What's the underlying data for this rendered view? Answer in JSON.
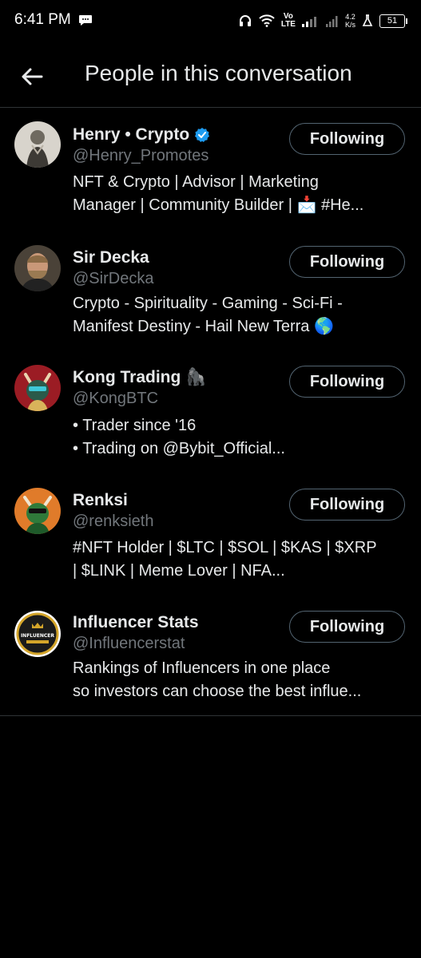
{
  "status_bar": {
    "time": "6:41 PM",
    "network_top": "Vo",
    "network_bottom": "LTE",
    "speed_top": "4.2",
    "speed_bottom": "K/s",
    "battery": "51"
  },
  "header": {
    "title": "People in this conversation"
  },
  "people": [
    {
      "name": "Henry • Crypto",
      "verified": true,
      "emoji": "",
      "handle": "@Henry_Promotes",
      "bio_line1": "NFT & Crypto | Advisor | Marketing",
      "bio_line2": "Manager | Community Builder | 📩  #He...",
      "button": "Following"
    },
    {
      "name": "Sir Decka",
      "verified": false,
      "emoji": "",
      "handle": "@SirDecka",
      "bio_line1": "Crypto - Spirituality - Gaming - Sci-Fi -",
      "bio_line2": "Manifest Destiny - Hail New Terra 🌎",
      "button": "Following"
    },
    {
      "name": "Kong Trading",
      "verified": false,
      "emoji": "🦍",
      "handle": "@KongBTC",
      "bio_line1": "• Trader since '16",
      "bio_line2": "• Trading on @Bybit_Official...",
      "button": "Following"
    },
    {
      "name": "Renksi",
      "verified": false,
      "emoji": "",
      "handle": "@renksieth",
      "bio_line1": "#NFT Holder | $LTC | $SOL | $KAS | $XRP",
      "bio_line2": "| $LINK | Meme Lover | NFA...",
      "button": "Following"
    },
    {
      "name": "Influencer Stats",
      "verified": false,
      "emoji": "",
      "handle": "@Influencerstat",
      "bio_line1": "Rankings of Influencers in one place",
      "bio_line2": "so investors can choose the best influe...",
      "button": "Following",
      "avatar_text": "INFLUENCER"
    }
  ],
  "colors": {
    "background": "#000000",
    "text": "#e7e9ea",
    "secondary": "#71767b",
    "verified": "#1d9bf0",
    "border": "#2f3336"
  }
}
